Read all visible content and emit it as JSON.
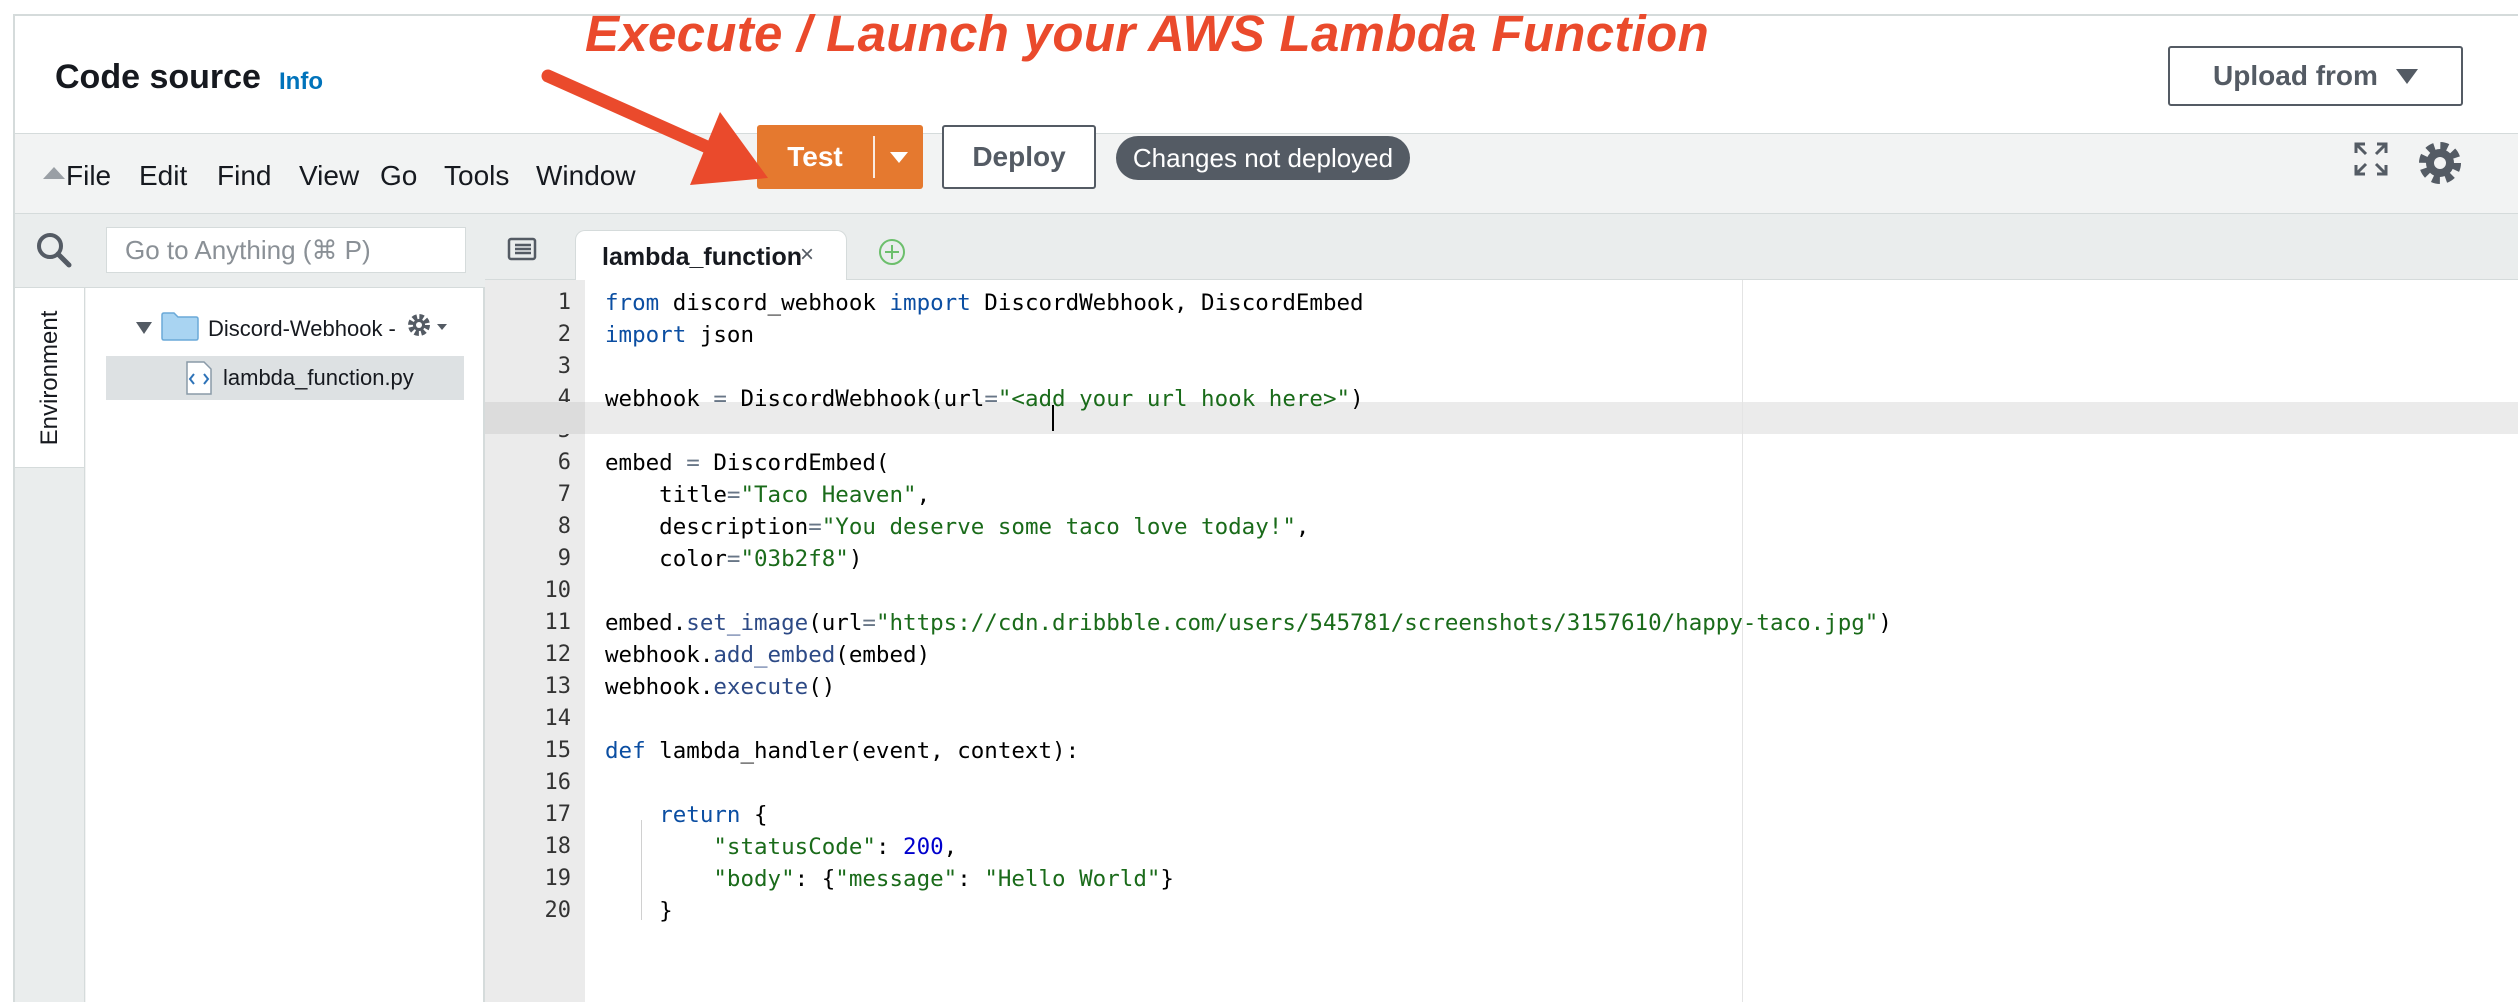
{
  "annotation": {
    "text": "Execute / Launch your AWS Lambda Function",
    "color": "#ea4a2c"
  },
  "header": {
    "title": "Code source",
    "info_link": "Info",
    "upload_button": "Upload from"
  },
  "menubar": {
    "items": [
      "File",
      "Edit",
      "Find",
      "View",
      "Go",
      "Tools",
      "Window"
    ],
    "test_button": "Test",
    "deploy_button": "Deploy",
    "status_badge": "Changes not deployed"
  },
  "sidebar": {
    "search_placeholder": "Go to Anything (⌘ P)",
    "environment_tab": "Environment",
    "folder": "Discord-Webhook -",
    "file": "lambda_function.py"
  },
  "editor": {
    "tab": "lambda_function",
    "tab_close": "×",
    "active_line": 4,
    "line_numbers": [
      "1",
      "2",
      "3",
      "4",
      "5",
      "6",
      "7",
      "8",
      "9",
      "10",
      "11",
      "12",
      "13",
      "14",
      "15",
      "16",
      "17",
      "18",
      "19",
      "20"
    ],
    "lines": [
      "from discord_webhook import DiscordWebhook, DiscordEmbed",
      "import json",
      "",
      "webhook = DiscordWebhook(url=\"<add your url hook here>\")",
      "",
      "embed = DiscordEmbed(",
      "    title=\"Taco Heaven\",",
      "    description=\"You deserve some taco love today!\",",
      "    color=\"03b2f8\")",
      "",
      "embed.set_image(url=\"https://cdn.dribbble.com/users/545781/screenshots/3157610/happy-taco.jpg\")",
      "webhook.add_embed(embed)",
      "webhook.execute()",
      "",
      "def lambda_handler(event, context):",
      "",
      "    return {",
      "        \"statusCode\": 200,",
      "        \"body\": {\"message\": \"Hello World\"}",
      "    }"
    ]
  },
  "colors": {
    "accent_orange": "#e5792f",
    "badge_gray": "#545b64",
    "link_blue": "#0073bb",
    "keyword": "#0b4ea2",
    "string": "#1a6b1a",
    "number": "#0000cd"
  },
  "icons": [
    "search-icon",
    "folder-icon",
    "gear-icon",
    "python-file-icon",
    "fullscreen-icon",
    "tab-list-icon",
    "add-tab-icon",
    "collapse-icon",
    "chevron-down-icon"
  ]
}
